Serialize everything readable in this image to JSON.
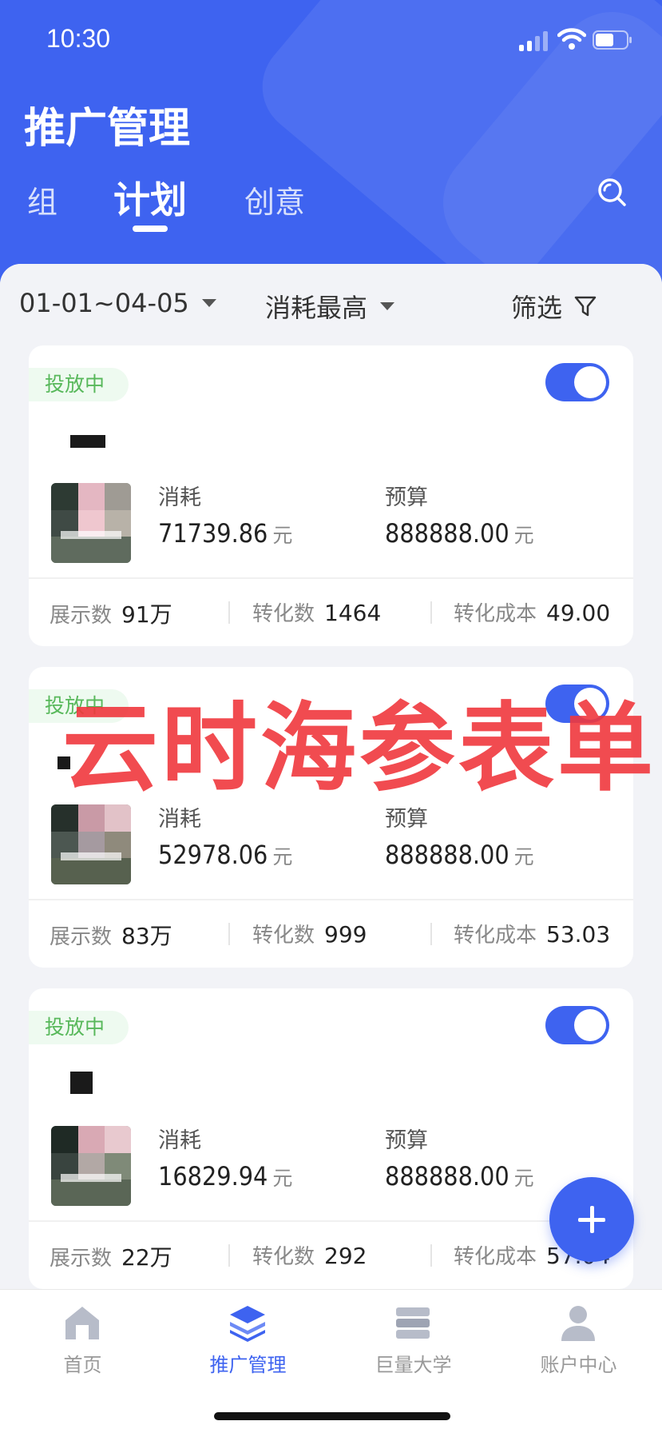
{
  "status_bar": {
    "time": "10:30"
  },
  "header": {
    "title": "推广管理",
    "tabs": [
      {
        "label": "组"
      },
      {
        "label": "计划"
      },
      {
        "label": "创意"
      }
    ]
  },
  "filters": {
    "date_range": "01-01~04-05",
    "sort": "消耗最高",
    "filter_label": "筛选"
  },
  "cards": [
    {
      "status": "投放中",
      "spend_label": "消耗",
      "spend_value": "71739.86",
      "spend_unit": "元",
      "budget_label": "预算",
      "budget_value": "888888.00",
      "budget_unit": "元",
      "impressions_label": "展示数",
      "impressions_value": "91万",
      "conversions_label": "转化数",
      "conversions_value": "1464",
      "cost_label": "转化成本",
      "cost_value": "49.00"
    },
    {
      "status": "投放中",
      "spend_label": "消耗",
      "spend_value": "52978.06",
      "spend_unit": "元",
      "budget_label": "预算",
      "budget_value": "888888.00",
      "budget_unit": "元",
      "impressions_label": "展示数",
      "impressions_value": "83万",
      "conversions_label": "转化数",
      "conversions_value": "999",
      "cost_label": "转化成本",
      "cost_value": "53.03"
    },
    {
      "status": "投放中",
      "spend_label": "消耗",
      "spend_value": "16829.94",
      "spend_unit": "元",
      "budget_label": "预算",
      "budget_value": "888888.00",
      "budget_unit": "元",
      "impressions_label": "展示数",
      "impressions_value": "22万",
      "conversions_label": "转化数",
      "conversions_value": "292",
      "cost_label": "转化成本",
      "cost_value": "57.04"
    }
  ],
  "watermark": "云时海参表单",
  "tabbar": {
    "items": [
      {
        "label": "首页",
        "icon": "home-icon"
      },
      {
        "label": "推广管理",
        "icon": "layers-icon"
      },
      {
        "label": "巨量大学",
        "icon": "books-icon"
      },
      {
        "label": "账户中心",
        "icon": "user-icon"
      }
    ],
    "active_index": 1
  },
  "colors": {
    "brand": "#3e63f0",
    "status_green": "#58b85b",
    "watermark": "#f0383e"
  }
}
